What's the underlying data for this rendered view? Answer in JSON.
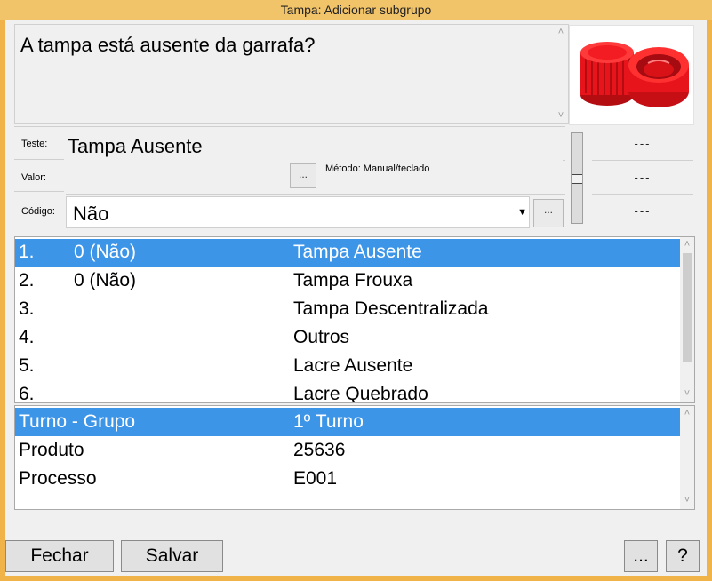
{
  "window": {
    "title": "Tampa: Adicionar subgrupo"
  },
  "question": {
    "text": "A tampa está ausente da garrafa?"
  },
  "fields": {
    "teste_label": "Teste:",
    "teste_value": "Tampa Ausente",
    "valor_label": "Valor:",
    "valor_value": "",
    "metodo_text": "Método: Manual/teclado",
    "codigo_label": "Código:",
    "codigo_value": "Não",
    "ellipsis": "..."
  },
  "readouts": [
    "---",
    "---",
    "---"
  ],
  "defects": [
    {
      "n": "1.",
      "code": "0 (Não)",
      "name": "Tampa Ausente",
      "selected": true
    },
    {
      "n": "2.",
      "code": "0 (Não)",
      "name": "Tampa Frouxa",
      "selected": false
    },
    {
      "n": "3.",
      "code": "",
      "name": "Tampa Descentralizada",
      "selected": false
    },
    {
      "n": "4.",
      "code": "",
      "name": "Outros",
      "selected": false
    },
    {
      "n": "5.",
      "code": "",
      "name": "Lacre Ausente",
      "selected": false
    },
    {
      "n": "6.",
      "code": "",
      "name": "Lacre Quebrado",
      "selected": false
    }
  ],
  "context": [
    {
      "key": "Turno - Grupo",
      "value": "1º  Turno",
      "selected": true
    },
    {
      "key": "Produto",
      "value": "25636",
      "selected": false
    },
    {
      "key": "Processo",
      "value": "E001",
      "selected": false
    }
  ],
  "buttons": {
    "close": "Fechar",
    "save": "Salvar",
    "more": "...",
    "help": "?"
  },
  "colors": {
    "selection": "#3d95e8",
    "titlebar": "#f2c46a",
    "cap_red": "#e8141c"
  }
}
